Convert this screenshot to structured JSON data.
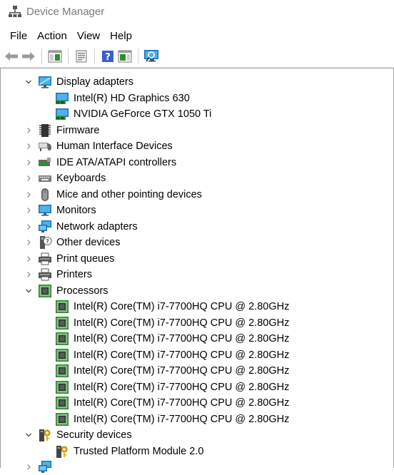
{
  "window": {
    "title": "Device Manager"
  },
  "menu": {
    "file": "File",
    "action": "Action",
    "view": "View",
    "help": "Help"
  },
  "tree": {
    "display_adapters": {
      "label": "Display adapters",
      "children": [
        "Intel(R) HD Graphics 630",
        "NVIDIA GeForce GTX 1050 Ti"
      ]
    },
    "firmware": "Firmware",
    "hid": "Human Interface Devices",
    "ide": "IDE ATA/ATAPI controllers",
    "keyboards": "Keyboards",
    "mice": "Mice and other pointing devices",
    "monitors": "Monitors",
    "network": "Network adapters",
    "other": "Other devices",
    "print_queues": "Print queues",
    "printers": "Printers",
    "processors": {
      "label": "Processors",
      "children": [
        "Intel(R) Core(TM) i7-7700HQ CPU @ 2.80GHz",
        "Intel(R) Core(TM) i7-7700HQ CPU @ 2.80GHz",
        "Intel(R) Core(TM) i7-7700HQ CPU @ 2.80GHz",
        "Intel(R) Core(TM) i7-7700HQ CPU @ 2.80GHz",
        "Intel(R) Core(TM) i7-7700HQ CPU @ 2.80GHz",
        "Intel(R) Core(TM) i7-7700HQ CPU @ 2.80GHz",
        "Intel(R) Core(TM) i7-7700HQ CPU @ 2.80GHz",
        "Intel(R) Core(TM) i7-7700HQ CPU @ 2.80GHz"
      ]
    },
    "security": {
      "label": "Security devices",
      "children": [
        "Trusted Platform Module 2.0"
      ]
    }
  }
}
